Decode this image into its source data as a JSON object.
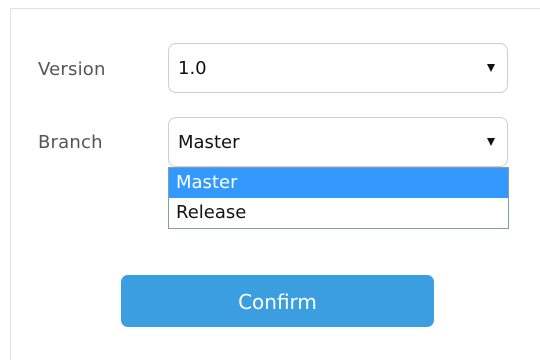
{
  "form": {
    "version": {
      "label": "Version",
      "value": "1.0",
      "icon": "caret-down-icon"
    },
    "branch": {
      "label": "Branch",
      "value": "Master",
      "icon": "caret-down-icon",
      "options": [
        "Master",
        "Release"
      ],
      "highlighted_option": "Master"
    },
    "confirm_label": "Confirm"
  },
  "colors": {
    "primary_button": "#3b9ee0",
    "option_highlight": "#3399ff",
    "label_text": "#555555"
  }
}
